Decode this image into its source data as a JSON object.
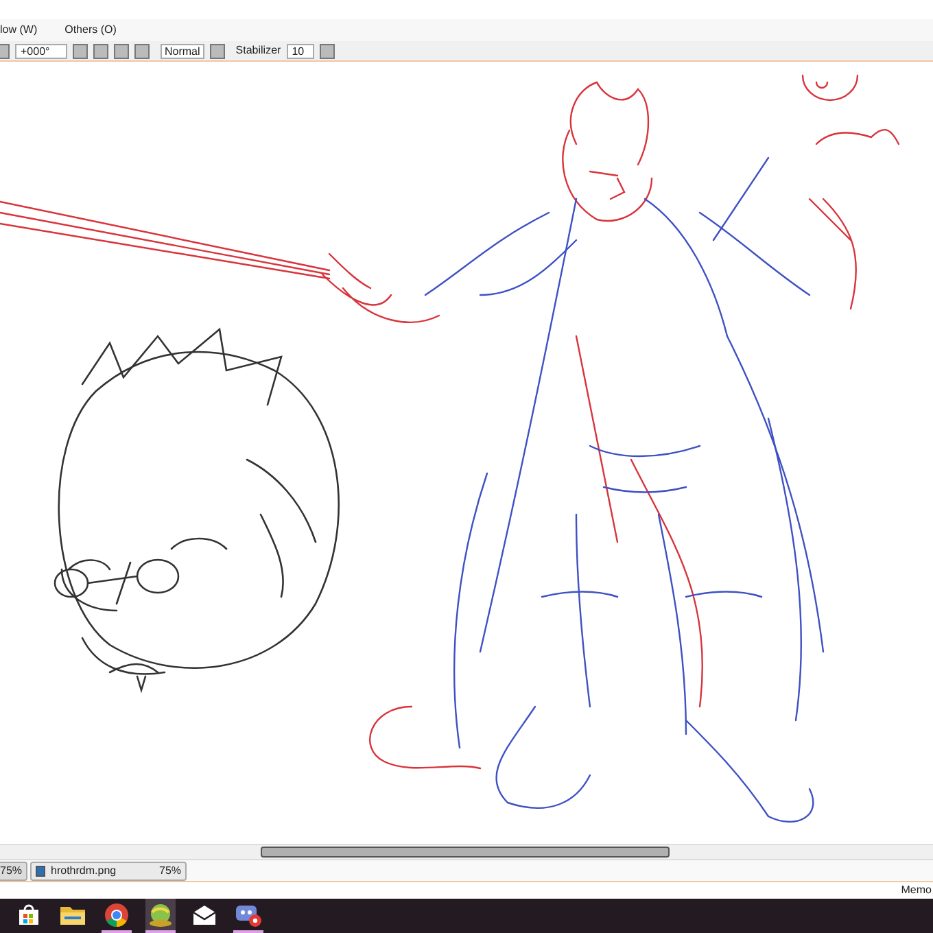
{
  "menu": [
    {
      "label": "low (W)"
    },
    {
      "label": "Others (O)"
    }
  ],
  "toolbar": {
    "angle": "+000°",
    "blend_mode": "Normal",
    "stabilizer_label": "Stabilizer",
    "stabilizer_value": "10"
  },
  "tabs": [
    {
      "zoom": "75%",
      "selected": false
    },
    {
      "name": "hrothrdm.png",
      "zoom": "75%",
      "selected": true
    }
  ],
  "status_bar": {
    "text": "Memo"
  },
  "taskbar": [
    {
      "kind": "store",
      "running": false,
      "selected": false
    },
    {
      "kind": "folder",
      "running": false,
      "selected": false
    },
    {
      "kind": "browser",
      "running": true,
      "selected": false
    },
    {
      "kind": "paint",
      "running": true,
      "selected": true
    },
    {
      "kind": "mail",
      "running": false,
      "selected": false
    },
    {
      "kind": "chat",
      "running": true,
      "selected": false
    }
  ]
}
